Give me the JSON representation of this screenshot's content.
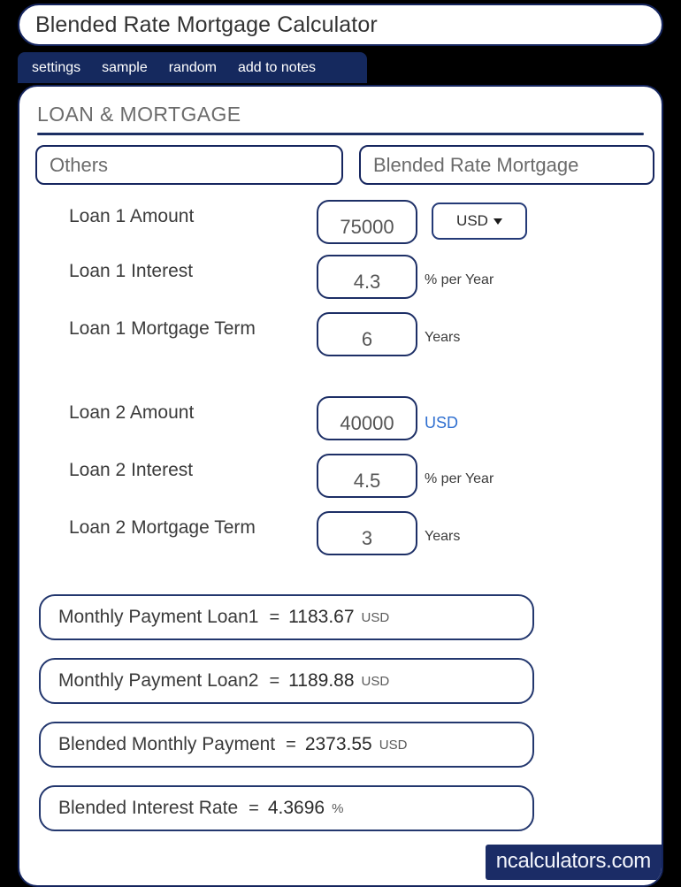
{
  "window": {
    "title": "Blended Rate Mortgage Calculator"
  },
  "tabs": [
    {
      "label": "settings"
    },
    {
      "label": "sample"
    },
    {
      "label": "random"
    },
    {
      "label": "add to notes"
    }
  ],
  "section": {
    "title": "LOAN & MORTGAGE"
  },
  "selectors": {
    "category": "Others",
    "calculator": "Blended Rate Mortgage"
  },
  "fields": [
    {
      "label": "Loan 1 Amount",
      "value": "75000",
      "unit": "",
      "currency": "USD",
      "has_currency_dropdown": true
    },
    {
      "label": "Loan 1 Interest",
      "value": "4.3",
      "unit": "% per Year",
      "has_currency_dropdown": false
    },
    {
      "label": "Loan 1 Mortgage Term",
      "value": "6",
      "unit": "Years",
      "has_currency_dropdown": false
    },
    {
      "label": "Loan 2 Amount",
      "value": "40000",
      "unit": "USD",
      "unit_style": "link",
      "has_currency_dropdown": false
    },
    {
      "label": "Loan 2 Interest",
      "value": "4.5",
      "unit": "% per Year",
      "has_currency_dropdown": false
    },
    {
      "label": "Loan 2 Mortgage Term",
      "value": "3",
      "unit": "Years",
      "has_currency_dropdown": false
    }
  ],
  "results": [
    {
      "label": "Monthly Payment Loan1",
      "equals": "=",
      "value": "1183.67",
      "unit": "USD"
    },
    {
      "label": "Monthly Payment Loan2",
      "equals": "=",
      "value": "1189.88",
      "unit": "USD"
    },
    {
      "label": "Blended Monthly Payment",
      "equals": "=",
      "value": "2373.55",
      "unit": "USD"
    },
    {
      "label": "Blended Interest Rate",
      "equals": "=",
      "value": "4.3696",
      "unit": "%"
    }
  ],
  "footer": {
    "brand": "ncalculators.com"
  },
  "colors": {
    "navy": "#15255e",
    "tab_bar": "#15295e",
    "link_blue": "#2f6fd0",
    "label_gray": "#3b3b3b",
    "background": "#000000"
  },
  "icons": {
    "caret": "chevron-down-icon"
  }
}
